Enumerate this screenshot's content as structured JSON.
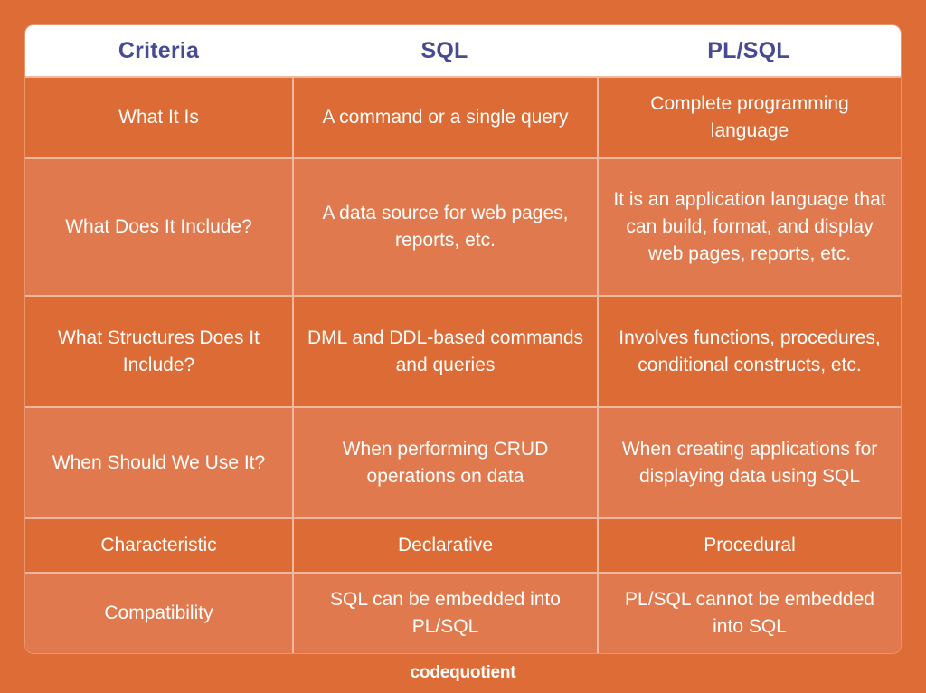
{
  "theme": {
    "background": "#de6c36",
    "row_dark": "#dc6b35",
    "row_light": "#e07a4e",
    "divider": "#f2b79f",
    "header_background": "#ffffff",
    "header_text": "#474b91",
    "body_text": "#ffffff"
  },
  "table": {
    "headers": [
      "Criteria",
      "SQL",
      "PL/SQL"
    ],
    "rows": [
      {
        "criteria": "What It Is",
        "sql": "A command or a single query",
        "plsql": "Complete programming language"
      },
      {
        "criteria": "What Does It Include?",
        "sql": "A data source for web pages, reports, etc.",
        "plsql": "It is an application language that can build, format, and display web pages, reports, etc."
      },
      {
        "criteria": "What Structures Does It Include?",
        "sql": "DML and DDL-based commands and queries",
        "plsql": "Involves functions, procedures, conditional constructs, etc."
      },
      {
        "criteria": "When Should We Use It?",
        "sql": "When performing CRUD operations on data",
        "plsql": "When creating applications for displaying data using SQL"
      },
      {
        "criteria": "Characteristic",
        "sql": "Declarative",
        "plsql": "Procedural"
      },
      {
        "criteria": "Compatibility",
        "sql": "SQL can be embedded into PL/SQL",
        "plsql": "PL/SQL cannot be embedded into SQL"
      }
    ]
  },
  "footer": {
    "brand_prefix": "code",
    "brand_suffix": "quotient"
  }
}
